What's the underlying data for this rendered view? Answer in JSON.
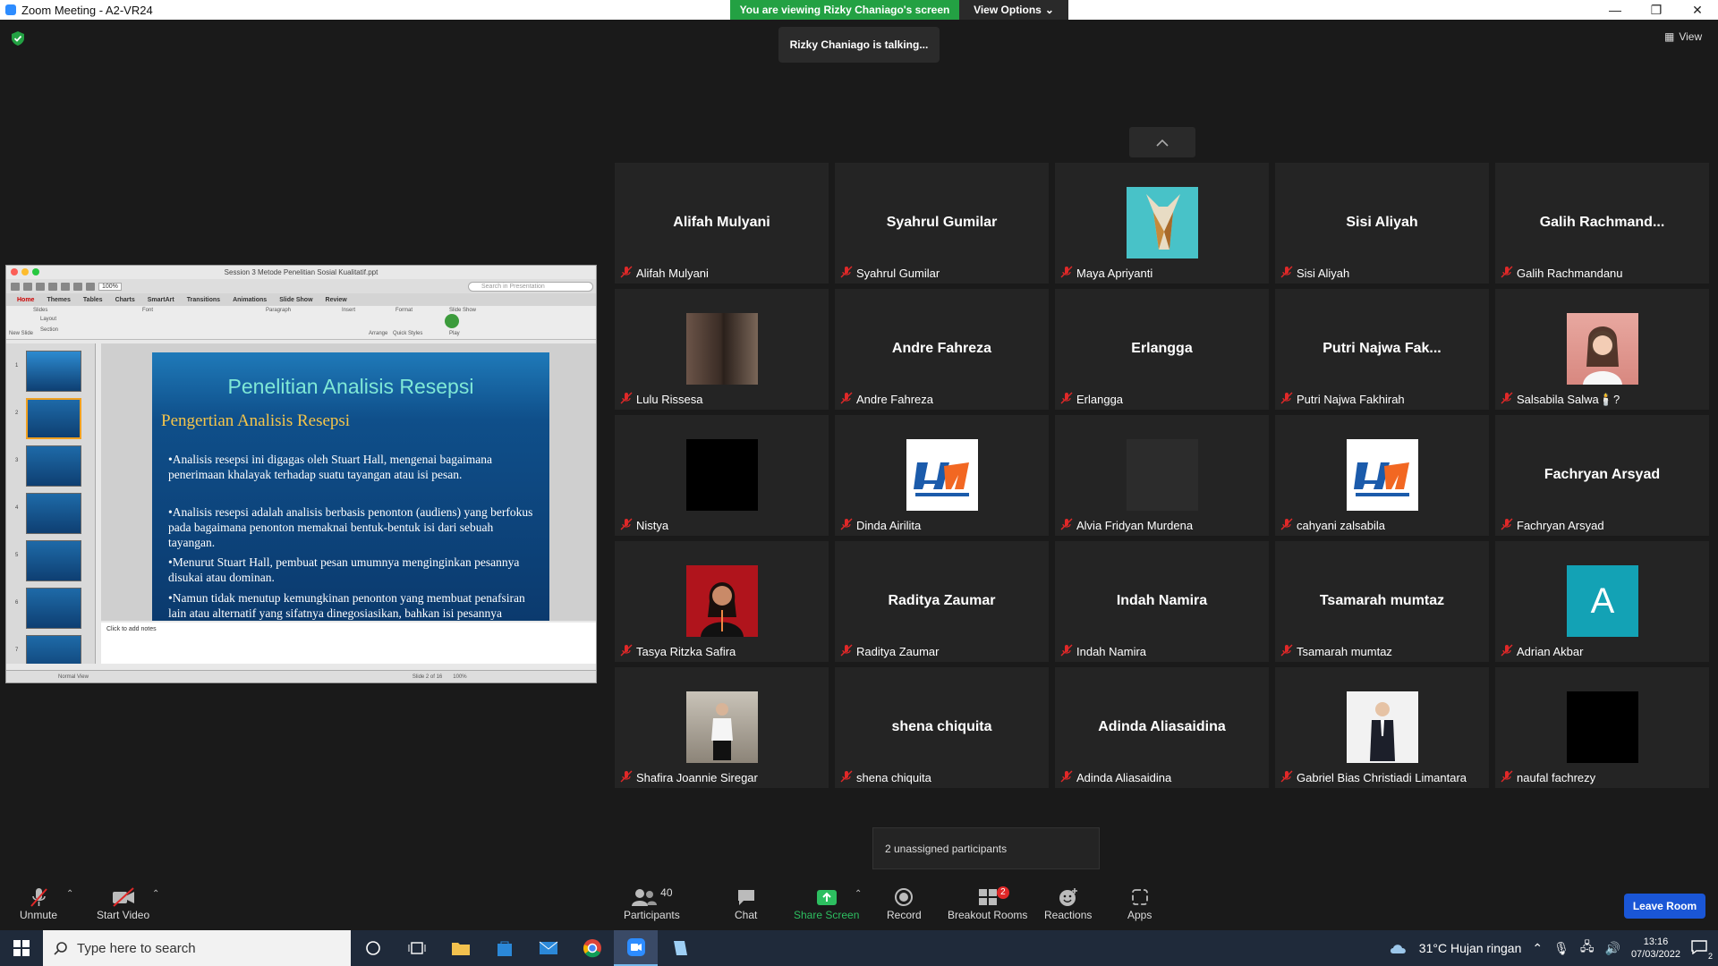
{
  "window": {
    "title": "Zoom Meeting - A2-VR24",
    "minimize": "—",
    "maximize": "❐",
    "close": "✕"
  },
  "banner": {
    "viewing": "You are viewing Rizky Chaniago's screen",
    "view_options": "View Options"
  },
  "talking": "Rizky Chaniago is talking...",
  "view_label": "View",
  "participants": [
    {
      "label": "Alifah Mulyani",
      "display": "Alifah Mulyani",
      "avatar": "none"
    },
    {
      "label": "Syahrul Gumilar",
      "display": "Syahrul Gumilar",
      "avatar": "none"
    },
    {
      "label": "Maya Apriyanti",
      "display": "",
      "avatar": "giraffe"
    },
    {
      "label": "Sisi Aliyah",
      "display": "Sisi Aliyah",
      "avatar": "none"
    },
    {
      "label": "Galih Rachmandanu",
      "display": "Galih  Rachmand...",
      "avatar": "none"
    },
    {
      "label": "Lulu Rissesa",
      "display": "",
      "avatar": "photo-duo"
    },
    {
      "label": "Andre Fahreza",
      "display": "Andre Fahreza",
      "avatar": "none"
    },
    {
      "label": "Erlangga",
      "display": "Erlangga",
      "avatar": "none"
    },
    {
      "label": "Putri Najwa Fakhirah",
      "display": "Putri  Najwa  Fak...",
      "avatar": "none"
    },
    {
      "label": "Salsabila Salwa🕯️?",
      "display": "",
      "avatar": "photo-pink"
    },
    {
      "label": "Nistya",
      "display": "",
      "avatar": "black"
    },
    {
      "label": "Dinda Airilita",
      "display": "",
      "avatar": "logo-hm"
    },
    {
      "label": "Alvia Fridyan Murdena",
      "display": "",
      "avatar": "dark"
    },
    {
      "label": "cahyani zalsabila",
      "display": "",
      "avatar": "logo-hm"
    },
    {
      "label": "Fachryan Arsyad",
      "display": "Fachryan Arsyad",
      "avatar": "none"
    },
    {
      "label": "Tasya Ritzka Safira",
      "display": "",
      "avatar": "photo-red"
    },
    {
      "label": "Raditya Zaumar",
      "display": "Raditya Zaumar",
      "avatar": "none"
    },
    {
      "label": "Indah Namira",
      "display": "Indah Namira",
      "avatar": "none"
    },
    {
      "label": "Tsamarah mumtaz",
      "display": "Tsamarah mumtaz",
      "avatar": "none"
    },
    {
      "label": "Adrian Akbar",
      "display": "",
      "avatar": "letter-a",
      "letter": "A"
    },
    {
      "label": "Shafira Joannie Siregar",
      "display": "",
      "avatar": "photo-street"
    },
    {
      "label": "shena chiquita",
      "display": "shena chiquita",
      "avatar": "none"
    },
    {
      "label": "Adinda Aliasaidina",
      "display": "Adinda Aliasaidina",
      "avatar": "none"
    },
    {
      "label": "Gabriel Bias Christiadi Limantara",
      "display": "",
      "avatar": "photo-suit"
    },
    {
      "label": "naufal fachrezy",
      "display": "",
      "avatar": "black"
    }
  ],
  "ppt": {
    "window_title": "Session 3 Metode Penelitian Sosial Kualitatif.ppt",
    "search_placeholder": "Search in Presentation",
    "zoom": "100%",
    "tabs": [
      "Home",
      "Themes",
      "Tables",
      "Charts",
      "SmartArt",
      "Transitions",
      "Animations",
      "Slide Show",
      "Review"
    ],
    "ribbon_groups": [
      "Slides",
      "Font",
      "Paragraph",
      "Insert",
      "Format",
      "Slide Show"
    ],
    "ribbon_labels": [
      "New Slide",
      "Layout",
      "Section",
      "Arrange",
      "Quick Styles",
      "Play"
    ],
    "slide_title": "Penelitian Analisis Resepsi",
    "slide_subtitle": "Pengertian Analisis Resepsi",
    "bullets": [
      "•Analisis resepsi ini digagas oleh Stuart Hall, mengenai bagaimana penerimaan khalayak terhadap suatu tayangan atau isi pesan.",
      "•Analisis resepsi adalah analisis berbasis penonton (audiens) yang  berfokus pada bagaimana penonton memaknai bentuk-bentuk isi dari  sebuah tayangan.",
      "•Menurut Stuart Hall, pembuat pesan umumnya menginginkan pesannya  disukai atau dominan.",
      "•Namun tidak menutup kemungkinan penonton yang membuat penafsiran lain atau alternatif yang sifatnya dinegosiasikan, bahkan isi  pesannya ditolak."
    ],
    "notes": "Click to add notes",
    "status_view": "Normal View",
    "status_slide": "Slide 2 of 16",
    "status_zoom": "100%",
    "thumb_numbers": [
      "1",
      "2",
      "3",
      "4",
      "5",
      "6",
      "7"
    ]
  },
  "unassigned": "2 unassigned participants",
  "toolbar": {
    "unmute": "Unmute",
    "start_video": "Start Video",
    "participants": "Participants",
    "participants_count": "40",
    "chat": "Chat",
    "share_screen": "Share Screen",
    "record": "Record",
    "breakout": "Breakout Rooms",
    "breakout_badge": "2",
    "reactions": "Reactions",
    "apps": "Apps",
    "leave": "Leave Room"
  },
  "taskbar": {
    "search_placeholder": "Type here to search",
    "weather": "31°C  Hujan ringan",
    "time": "13:16",
    "date": "07/03/2022",
    "notif_count": "2"
  }
}
